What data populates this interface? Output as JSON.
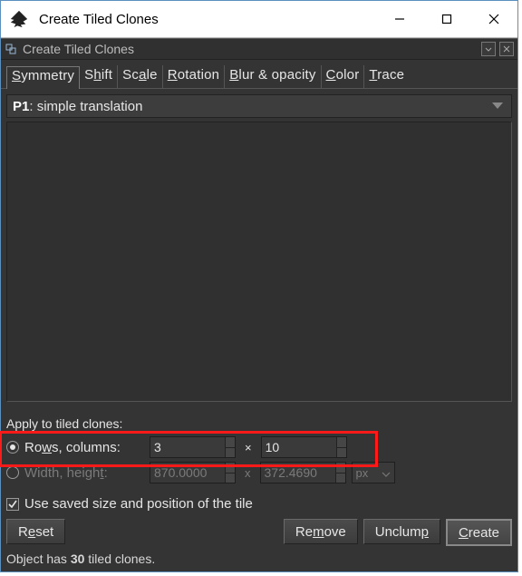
{
  "window": {
    "title": "Create Tiled Clones"
  },
  "dock": {
    "title": "Create Tiled Clones"
  },
  "tabs": {
    "symmetry": "Symmetry",
    "shift": "Shift",
    "scale": "Scale",
    "rotation": "Rotation",
    "blur_opacity": "Blur & opacity",
    "color": "Color",
    "trace": "Trace"
  },
  "symmetry_group": {
    "code": "P1",
    "label": ": simple translation"
  },
  "apply_section": {
    "heading": "Apply to tiled clones:",
    "rows_cols_label": "Rows, columns:",
    "rows_value": "3",
    "cols_value": "10",
    "width_height_label": "Width, height:",
    "width_value": "870.0000",
    "height_value": "372.4690",
    "unit": "px",
    "mult_a": "×",
    "mult_b": "x"
  },
  "use_saved": {
    "label": "Use saved size and position of the tile",
    "checked": true
  },
  "buttons": {
    "reset": "Reset",
    "remove": "Remove",
    "unclump": "Unclump",
    "create": "Create"
  },
  "status": {
    "prefix": "Object has ",
    "count": "30",
    "suffix": " tiled clones."
  }
}
